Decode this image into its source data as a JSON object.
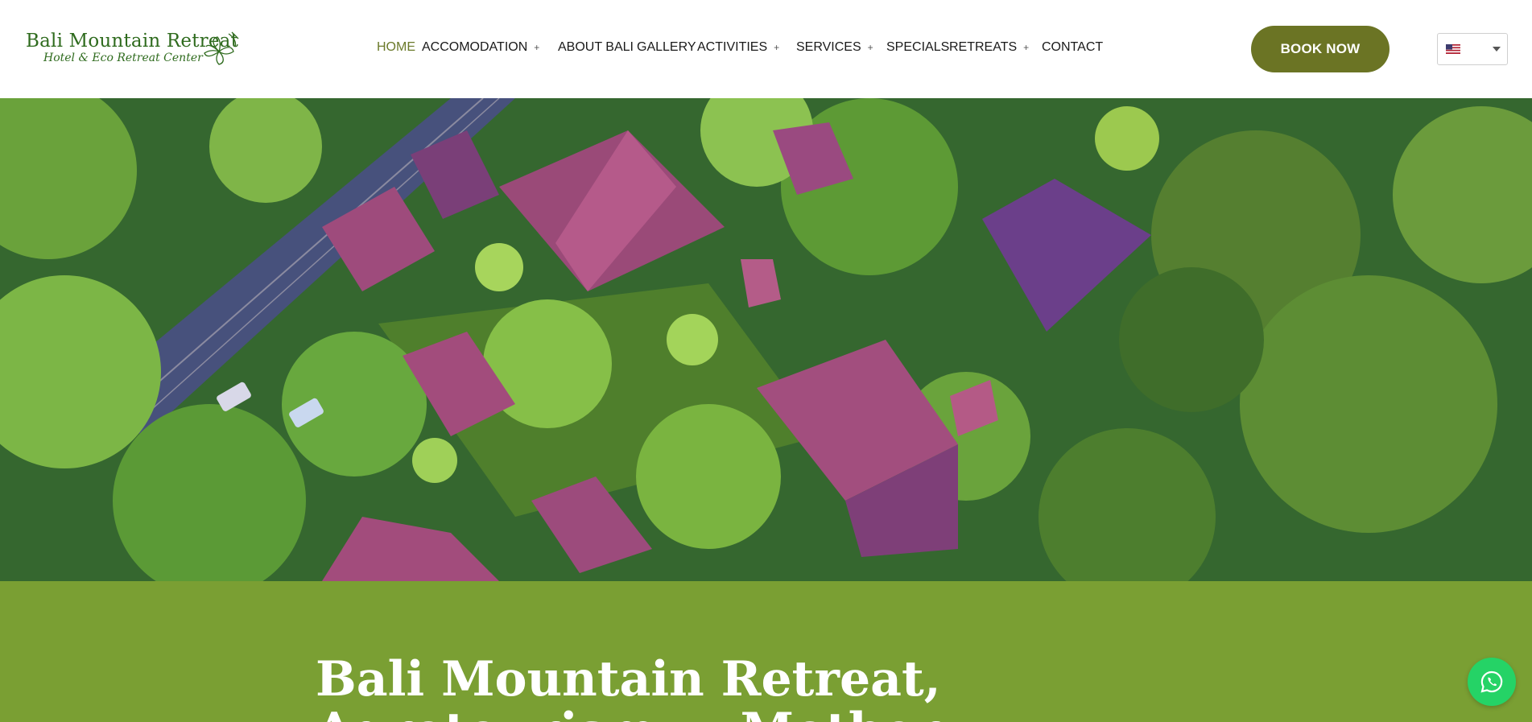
{
  "logo": {
    "title": "Bali Mountain Retreat",
    "subtitle": "Hotel & Eco Retreat Center"
  },
  "nav": [
    {
      "label": "HOME",
      "has_submenu": false,
      "active": true
    },
    {
      "label": "ACCOMODATION",
      "has_submenu": true
    },
    {
      "label": "ABOUT BALI",
      "has_submenu": false
    },
    {
      "label": "GALLERY",
      "has_submenu": false
    },
    {
      "label": "ACTIVITIES",
      "has_submenu": true
    },
    {
      "label": "SERVICES",
      "has_submenu": true
    },
    {
      "label": "SPECIALS",
      "has_submenu": false
    },
    {
      "label": "RETREATS",
      "has_submenu": true
    },
    {
      "label": "CONTACT",
      "has_submenu": false
    }
  ],
  "submenu_glyph": "+",
  "book_button": {
    "label": "BOOK NOW"
  },
  "language": {
    "selected_flag": "us-flag-icon"
  },
  "hero": {
    "description_icon": "aerial-photo"
  },
  "intro": {
    "title": "Bali Mountain Retreat, Agrotourism ... Mother"
  },
  "colors": {
    "brand_green": "#6b7424",
    "section_green": "#7a9f33",
    "active_nav": "#6b7a2a",
    "whatsapp": "#25d366"
  },
  "floating": {
    "icon": "whatsapp-icon"
  }
}
